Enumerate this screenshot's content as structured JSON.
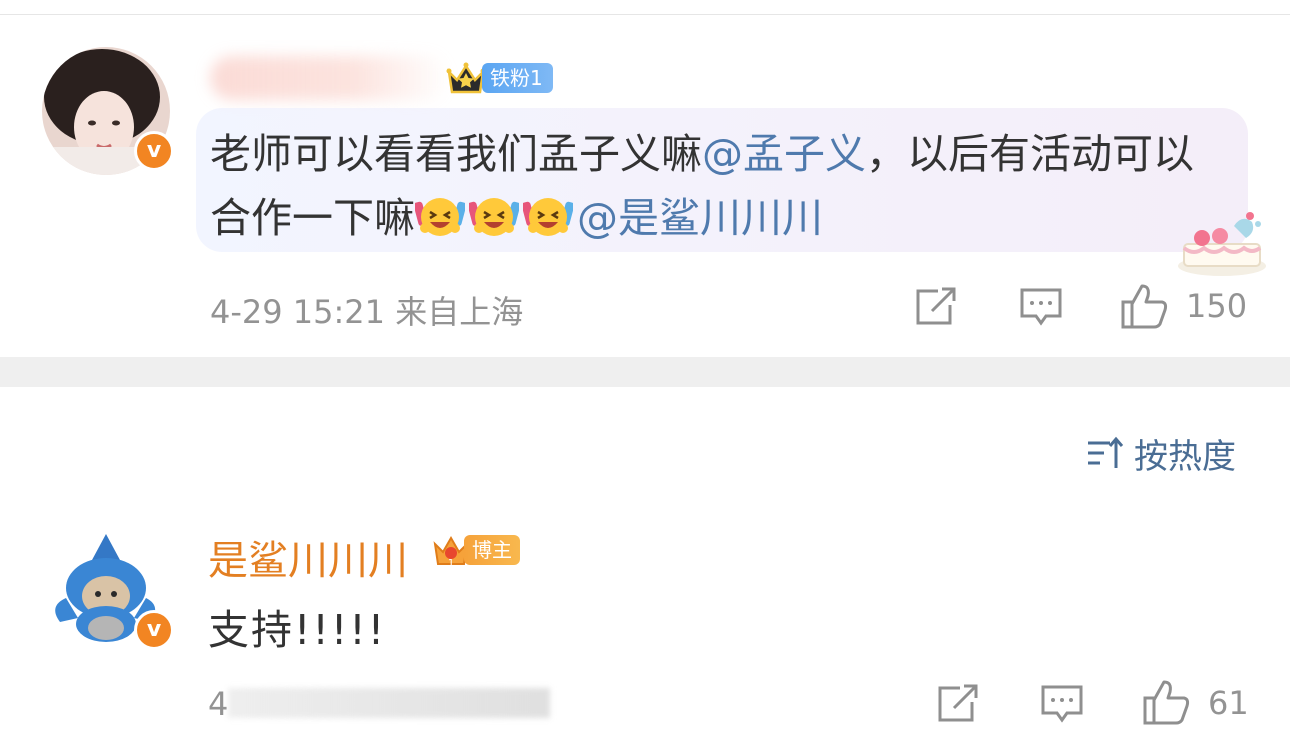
{
  "comments": [
    {
      "badge_label": "铁粉1",
      "text_parts": [
        {
          "type": "text",
          "value": "老师可以看看我们孟子义嘛"
        },
        {
          "type": "mention",
          "value": "@孟子义"
        },
        {
          "type": "text",
          "value": "，以后有活动可以合作一下嘛"
        },
        {
          "type": "emoji",
          "value": "haha-emoji"
        },
        {
          "type": "emoji",
          "value": "haha-emoji"
        },
        {
          "type": "emoji",
          "value": "haha-emoji"
        },
        {
          "type": "mention",
          "value": "@是鲨川川川"
        }
      ],
      "time": "4-29 15:21",
      "location": "来自上海",
      "likes": "150",
      "avatar_icon": "user-avatar-woman",
      "verified_icon": "verified-v-icon"
    }
  ],
  "sort": {
    "label": "按热度",
    "icon": "sort-icon"
  },
  "reply": {
    "author": "是鲨川川川",
    "badge_label": "博主",
    "text": "支持!!!!!",
    "date_visible": "4",
    "likes": "61",
    "avatar_icon": "user-avatar-shark",
    "verified_icon": "verified-v-icon"
  },
  "colors": {
    "mention": "#4f7aad",
    "author_orange": "#e37f22",
    "meta_gray": "#939393",
    "fan_badge_blue": "#5aa5f2",
    "host_badge_orange": "#f6a23a",
    "verified_orange": "#f28522"
  }
}
